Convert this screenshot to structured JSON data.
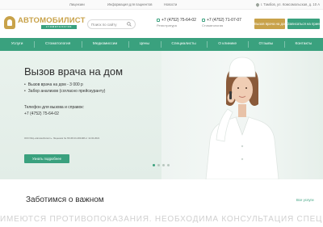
{
  "topbar": {
    "links": [
      "Лицензии",
      "Информация для пациентов",
      "Новости"
    ],
    "address": "г. Тамбов, ул. Комсомольская, д. 10 А"
  },
  "header": {
    "logo_name": "АВТОМОБИЛИСТ",
    "logo_sub": "стоматология",
    "search_placeholder": "Поиск по сайту",
    "phones": [
      {
        "number": "+7 (4752) 75-64-02",
        "caption": "Регистратура"
      },
      {
        "number": "+7 (4752) 71-07-07",
        "caption": "Стоматология"
      }
    ],
    "call_doctor_label": "Вызов врача на дом",
    "appointment_label": "Записаться на прием"
  },
  "nav": {
    "items": [
      "Услуги",
      "Стоматология",
      "Медкомиссии",
      "Цены",
      "Специалисты",
      "О клинике",
      "Отзывы",
      "Контакты"
    ]
  },
  "hero": {
    "title": "Вызов врача на дом",
    "bullets": [
      "Вызов врача на дом - 3 000 р",
      "Забор анализов (согласно прейскуранту)"
    ],
    "tel_label": "Телефон для вызова и справок:",
    "tel": "+7 (4752) 75-64-02",
    "license": "ООО МЦ «Автомобилист». Лицензия № ЛО-68-01-001198 от 12.02.2021",
    "button_label": "Узнать подробнее",
    "slides_total": 4,
    "slide_active": 1
  },
  "section": {
    "title": "Заботимся о важном",
    "all_link": "Все услуги"
  },
  "disclaimer": "ИМЕЮТСЯ ПРОТИВОПОКАЗАНИЯ. НЕОБХОДИМА КОНСУЛЬТАЦИЯ СПЕЦИАЛИСТА",
  "colors": {
    "brand_green": "#3aa17e",
    "brand_gold": "#c8a24a"
  }
}
